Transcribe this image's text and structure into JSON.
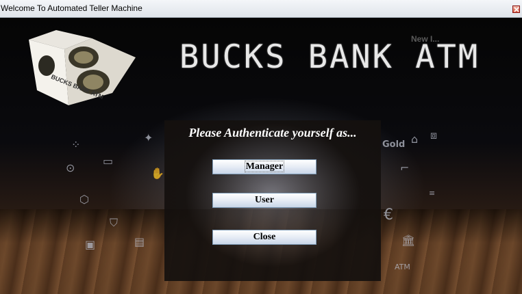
{
  "window": {
    "title": "Welcome To Automated Teller Machine",
    "close_icon": "close-icon"
  },
  "header": {
    "brand": "BUCKS BANK ATM",
    "new_tag": "New I..."
  },
  "logo": {
    "cube_text": "BUCKS BANK ATM"
  },
  "panel": {
    "heading": "Please Authenticate yourself as...",
    "buttons": {
      "manager": "Manager",
      "user": "User",
      "close": "Close"
    }
  },
  "decor": {
    "gold_label": "Gold",
    "atm_label": "ATM",
    "dollar_symbol": "$"
  }
}
